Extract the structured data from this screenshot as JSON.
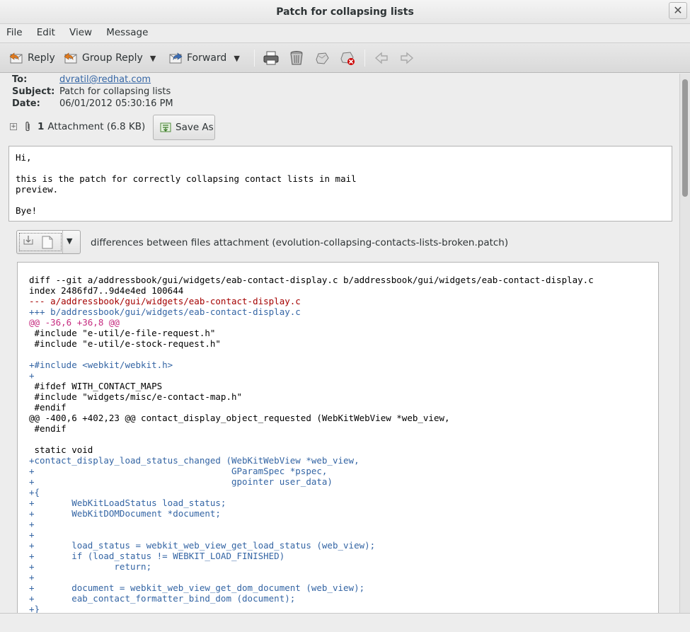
{
  "window": {
    "title": "Patch for collapsing lists",
    "close_glyph": "✕"
  },
  "menu": [
    "File",
    "Edit",
    "View",
    "Message"
  ],
  "toolbar": {
    "reply": "Reply",
    "group_reply": "Group Reply",
    "forward": "Forward",
    "icons": [
      "print-icon",
      "delete-icon",
      "junk-icon",
      "not-junk-icon",
      "previous-icon",
      "next-icon"
    ]
  },
  "headers": {
    "to_label": "To:",
    "to_value": "dvratil@redhat.com",
    "subject_label": "Subject:",
    "subject_value": "Patch for collapsing lists",
    "date_label": "Date:",
    "date_value": "06/01/2012 05:30:16 PM"
  },
  "attachments": {
    "expander": "+",
    "count": "1",
    "summary": "Attachment (6.8 KB)",
    "save_as": "Save As"
  },
  "message_body": "Hi,\n\nthis is the patch for correctly collapsing contact lists in mail\npreview.\n\nBye!",
  "attachment_label": "differences between files attachment (evolution-collapsing-contacts-lists-broken.patch)",
  "patch_lines": [
    "diff --git a/addressbook/gui/widgets/eab-contact-display.c b/addressbook/gui/widgets/eab-contact-display.c",
    "index 2486fd7..9d4e4ed 100644",
    "--- a/addressbook/gui/widgets/eab-contact-display.c",
    "+++ b/addressbook/gui/widgets/eab-contact-display.c",
    "@@ -36,6 +36,8 @@",
    " #include \"e-util/e-file-request.h\"",
    " #include \"e-util/e-stock-request.h\"",
    "",
    "+#include <webkit/webkit.h>",
    "+",
    " #ifdef WITH_CONTACT_MAPS",
    " #include \"widgets/misc/e-contact-map.h\"",
    " #endif",
    "@@ -400,6 +402,23 @@ contact_display_object_requested (WebKitWebView *web_view,",
    " #endif",
    "",
    " static void",
    "+contact_display_load_status_changed (WebKitWebView *web_view,",
    "+                                     GParamSpec *pspec,",
    "+                                     gpointer user_data)",
    "+{",
    "+       WebKitLoadStatus load_status;",
    "+       WebKitDOMDocument *document;",
    "+",
    "+",
    "+       load_status = webkit_web_view_get_load_status (web_view);",
    "+       if (load_status != WEBKIT_LOAD_FINISHED)",
    "+               return;",
    "+",
    "+       document = webkit_web_view_get_dom_document (web_view);",
    "+       eab_contact_formatter_bind_dom (document);",
    "+}"
  ],
  "patch_line_styles": [
    "plain",
    "plain",
    "del",
    "add",
    "hunk",
    "plain",
    "plain",
    "plain",
    "add",
    "add",
    "plain",
    "plain",
    "plain",
    "plain",
    "plain",
    "plain",
    "plain",
    "add",
    "add",
    "add",
    "add",
    "add",
    "add",
    "add",
    "add",
    "add",
    "add",
    "add",
    "add",
    "add",
    "add",
    "add"
  ],
  "colors": {
    "link": "#3465a4",
    "added": "#3465a4",
    "removed": "#a40000",
    "hunk": "#c62d80"
  }
}
